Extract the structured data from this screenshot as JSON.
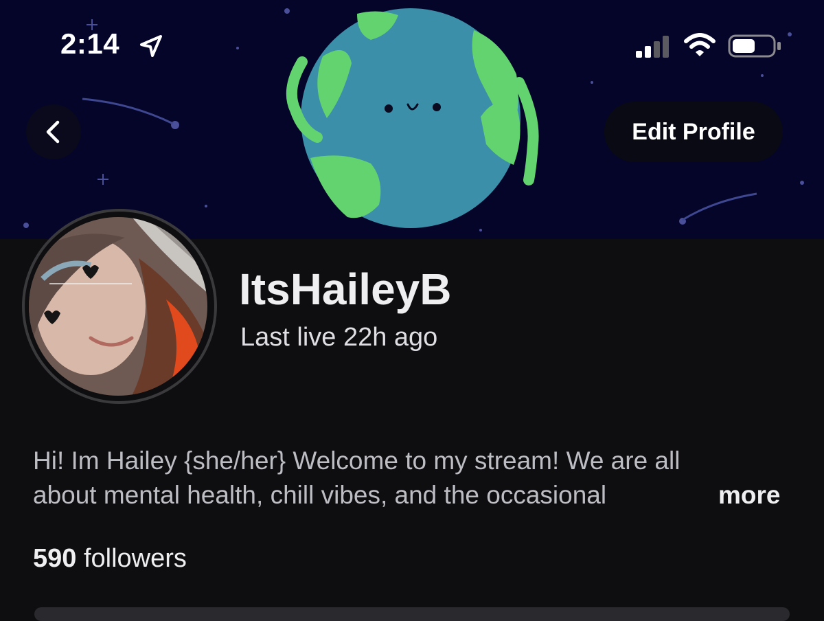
{
  "status_bar": {
    "time": "2:14",
    "icons": [
      "location-arrow-icon",
      "signal-icon",
      "wifi-icon",
      "battery-icon"
    ]
  },
  "header": {
    "back_icon": "chevron-left-icon",
    "edit_label": "Edit Profile"
  },
  "profile": {
    "username": "ItsHaileyB",
    "last_live": "Last live 22h ago",
    "bio_line1": "Hi! Im Hailey {she/her} Welcome to my stream! We are all",
    "bio_line2": "about mental health, chill vibes, and the occasional",
    "more_label": "more",
    "followers_count": "590",
    "followers_label": " followers"
  },
  "colors": {
    "background": "#0e0e10",
    "banner": "#05052a",
    "globe_ocean": "#3c8fa8",
    "globe_land": "#62d36f"
  }
}
